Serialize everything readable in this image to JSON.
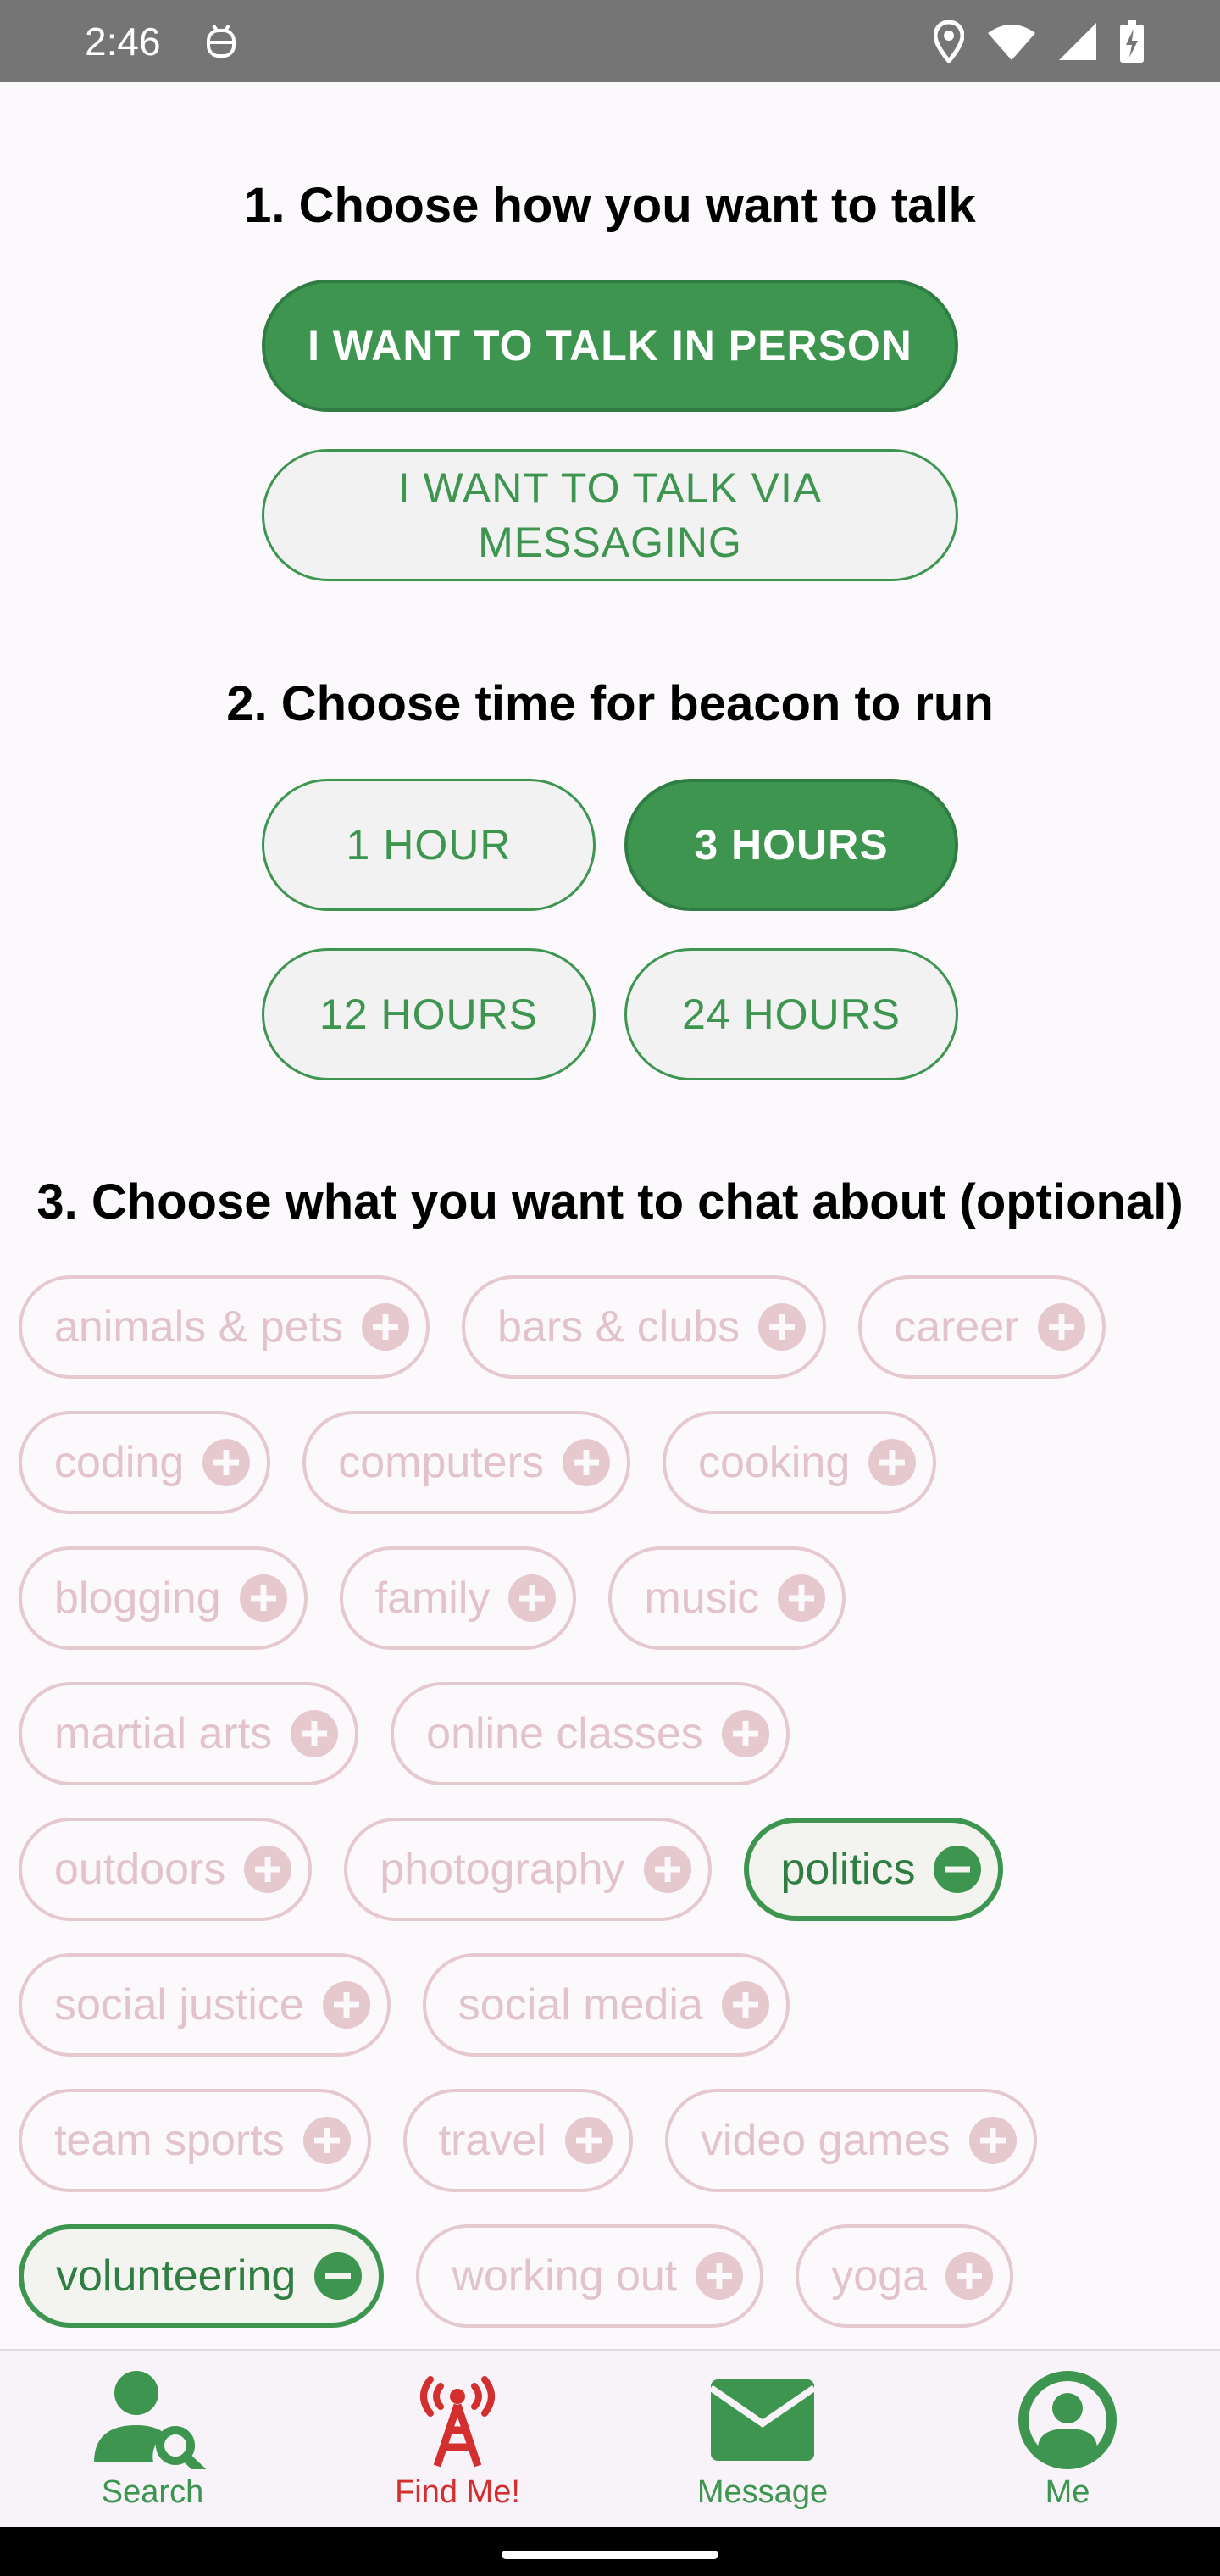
{
  "status_bar": {
    "time": "2:46",
    "icons": [
      "android-notification-icon",
      "location-icon",
      "wifi-icon",
      "cell-signal-icon",
      "battery-charging-icon"
    ]
  },
  "section1": {
    "title": "1. Choose how you want to talk",
    "options": [
      {
        "label": "I WANT TO TALK IN PERSON",
        "selected": true
      },
      {
        "label": "I WANT TO TALK VIA MESSAGING",
        "selected": false
      }
    ]
  },
  "section2": {
    "title": "2. Choose time for beacon to run",
    "options": [
      {
        "label": "1 HOUR",
        "selected": false
      },
      {
        "label": "3 HOURS",
        "selected": true
      },
      {
        "label": "12 HOURS",
        "selected": false
      },
      {
        "label": "24 HOURS",
        "selected": false
      }
    ]
  },
  "section3": {
    "title": "3. Choose what you want to chat about (optional)",
    "rows": [
      [
        {
          "label": "animals & pets",
          "selected": false
        },
        {
          "label": "bars & clubs",
          "selected": false
        },
        {
          "label": "career",
          "selected": false
        }
      ],
      [
        {
          "label": "coding",
          "selected": false
        },
        {
          "label": "computers",
          "selected": false
        },
        {
          "label": "cooking",
          "selected": false
        }
      ],
      [
        {
          "label": "blogging",
          "selected": false
        },
        {
          "label": "family",
          "selected": false
        },
        {
          "label": "music",
          "selected": false
        }
      ],
      [
        {
          "label": "martial arts",
          "selected": false
        },
        {
          "label": "online classes",
          "selected": false
        }
      ],
      [
        {
          "label": "outdoors",
          "selected": false
        },
        {
          "label": "photography",
          "selected": false
        },
        {
          "label": "politics",
          "selected": true
        }
      ],
      [
        {
          "label": "social justice",
          "selected": false
        },
        {
          "label": "social media",
          "selected": false
        }
      ],
      [
        {
          "label": "team sports",
          "selected": false
        },
        {
          "label": "travel",
          "selected": false
        },
        {
          "label": "video games",
          "selected": false
        }
      ],
      [
        {
          "label": "volunteering",
          "selected": true
        },
        {
          "label": "working out",
          "selected": false
        },
        {
          "label": "yoga",
          "selected": false
        }
      ]
    ]
  },
  "bottom_nav": [
    {
      "label": "Search",
      "icon": "search-person-icon",
      "color": "#3d9550"
    },
    {
      "label": "Find Me!",
      "icon": "beacon-antenna-icon",
      "color": "#d32f2f"
    },
    {
      "label": "Message",
      "icon": "envelope-icon",
      "color": "#3d9550"
    },
    {
      "label": "Me",
      "icon": "profile-icon",
      "color": "#3d9550"
    }
  ],
  "colors": {
    "accent": "#3d9550",
    "chip_inactive": "#e3c3cb",
    "alert": "#d32f2f",
    "status_bar": "#757575"
  }
}
